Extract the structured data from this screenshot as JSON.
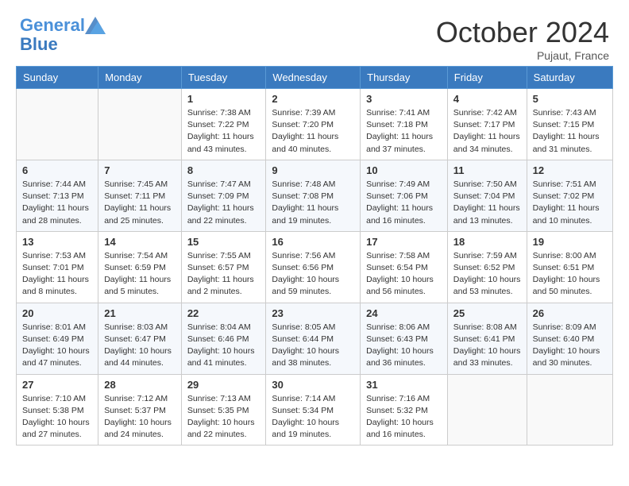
{
  "header": {
    "logo_line1": "General",
    "logo_line2": "Blue",
    "month": "October 2024",
    "location": "Pujaut, France"
  },
  "columns": [
    "Sunday",
    "Monday",
    "Tuesday",
    "Wednesday",
    "Thursday",
    "Friday",
    "Saturday"
  ],
  "weeks": [
    [
      {
        "day": "",
        "sunrise": "",
        "sunset": "",
        "daylight": ""
      },
      {
        "day": "",
        "sunrise": "",
        "sunset": "",
        "daylight": ""
      },
      {
        "day": "1",
        "sunrise": "Sunrise: 7:38 AM",
        "sunset": "Sunset: 7:22 PM",
        "daylight": "Daylight: 11 hours and 43 minutes."
      },
      {
        "day": "2",
        "sunrise": "Sunrise: 7:39 AM",
        "sunset": "Sunset: 7:20 PM",
        "daylight": "Daylight: 11 hours and 40 minutes."
      },
      {
        "day": "3",
        "sunrise": "Sunrise: 7:41 AM",
        "sunset": "Sunset: 7:18 PM",
        "daylight": "Daylight: 11 hours and 37 minutes."
      },
      {
        "day": "4",
        "sunrise": "Sunrise: 7:42 AM",
        "sunset": "Sunset: 7:17 PM",
        "daylight": "Daylight: 11 hours and 34 minutes."
      },
      {
        "day": "5",
        "sunrise": "Sunrise: 7:43 AM",
        "sunset": "Sunset: 7:15 PM",
        "daylight": "Daylight: 11 hours and 31 minutes."
      }
    ],
    [
      {
        "day": "6",
        "sunrise": "Sunrise: 7:44 AM",
        "sunset": "Sunset: 7:13 PM",
        "daylight": "Daylight: 11 hours and 28 minutes."
      },
      {
        "day": "7",
        "sunrise": "Sunrise: 7:45 AM",
        "sunset": "Sunset: 7:11 PM",
        "daylight": "Daylight: 11 hours and 25 minutes."
      },
      {
        "day": "8",
        "sunrise": "Sunrise: 7:47 AM",
        "sunset": "Sunset: 7:09 PM",
        "daylight": "Daylight: 11 hours and 22 minutes."
      },
      {
        "day": "9",
        "sunrise": "Sunrise: 7:48 AM",
        "sunset": "Sunset: 7:08 PM",
        "daylight": "Daylight: 11 hours and 19 minutes."
      },
      {
        "day": "10",
        "sunrise": "Sunrise: 7:49 AM",
        "sunset": "Sunset: 7:06 PM",
        "daylight": "Daylight: 11 hours and 16 minutes."
      },
      {
        "day": "11",
        "sunrise": "Sunrise: 7:50 AM",
        "sunset": "Sunset: 7:04 PM",
        "daylight": "Daylight: 11 hours and 13 minutes."
      },
      {
        "day": "12",
        "sunrise": "Sunrise: 7:51 AM",
        "sunset": "Sunset: 7:02 PM",
        "daylight": "Daylight: 11 hours and 10 minutes."
      }
    ],
    [
      {
        "day": "13",
        "sunrise": "Sunrise: 7:53 AM",
        "sunset": "Sunset: 7:01 PM",
        "daylight": "Daylight: 11 hours and 8 minutes."
      },
      {
        "day": "14",
        "sunrise": "Sunrise: 7:54 AM",
        "sunset": "Sunset: 6:59 PM",
        "daylight": "Daylight: 11 hours and 5 minutes."
      },
      {
        "day": "15",
        "sunrise": "Sunrise: 7:55 AM",
        "sunset": "Sunset: 6:57 PM",
        "daylight": "Daylight: 11 hours and 2 minutes."
      },
      {
        "day": "16",
        "sunrise": "Sunrise: 7:56 AM",
        "sunset": "Sunset: 6:56 PM",
        "daylight": "Daylight: 10 hours and 59 minutes."
      },
      {
        "day": "17",
        "sunrise": "Sunrise: 7:58 AM",
        "sunset": "Sunset: 6:54 PM",
        "daylight": "Daylight: 10 hours and 56 minutes."
      },
      {
        "day": "18",
        "sunrise": "Sunrise: 7:59 AM",
        "sunset": "Sunset: 6:52 PM",
        "daylight": "Daylight: 10 hours and 53 minutes."
      },
      {
        "day": "19",
        "sunrise": "Sunrise: 8:00 AM",
        "sunset": "Sunset: 6:51 PM",
        "daylight": "Daylight: 10 hours and 50 minutes."
      }
    ],
    [
      {
        "day": "20",
        "sunrise": "Sunrise: 8:01 AM",
        "sunset": "Sunset: 6:49 PM",
        "daylight": "Daylight: 10 hours and 47 minutes."
      },
      {
        "day": "21",
        "sunrise": "Sunrise: 8:03 AM",
        "sunset": "Sunset: 6:47 PM",
        "daylight": "Daylight: 10 hours and 44 minutes."
      },
      {
        "day": "22",
        "sunrise": "Sunrise: 8:04 AM",
        "sunset": "Sunset: 6:46 PM",
        "daylight": "Daylight: 10 hours and 41 minutes."
      },
      {
        "day": "23",
        "sunrise": "Sunrise: 8:05 AM",
        "sunset": "Sunset: 6:44 PM",
        "daylight": "Daylight: 10 hours and 38 minutes."
      },
      {
        "day": "24",
        "sunrise": "Sunrise: 8:06 AM",
        "sunset": "Sunset: 6:43 PM",
        "daylight": "Daylight: 10 hours and 36 minutes."
      },
      {
        "day": "25",
        "sunrise": "Sunrise: 8:08 AM",
        "sunset": "Sunset: 6:41 PM",
        "daylight": "Daylight: 10 hours and 33 minutes."
      },
      {
        "day": "26",
        "sunrise": "Sunrise: 8:09 AM",
        "sunset": "Sunset: 6:40 PM",
        "daylight": "Daylight: 10 hours and 30 minutes."
      }
    ],
    [
      {
        "day": "27",
        "sunrise": "Sunrise: 7:10 AM",
        "sunset": "Sunset: 5:38 PM",
        "daylight": "Daylight: 10 hours and 27 minutes."
      },
      {
        "day": "28",
        "sunrise": "Sunrise: 7:12 AM",
        "sunset": "Sunset: 5:37 PM",
        "daylight": "Daylight: 10 hours and 24 minutes."
      },
      {
        "day": "29",
        "sunrise": "Sunrise: 7:13 AM",
        "sunset": "Sunset: 5:35 PM",
        "daylight": "Daylight: 10 hours and 22 minutes."
      },
      {
        "day": "30",
        "sunrise": "Sunrise: 7:14 AM",
        "sunset": "Sunset: 5:34 PM",
        "daylight": "Daylight: 10 hours and 19 minutes."
      },
      {
        "day": "31",
        "sunrise": "Sunrise: 7:16 AM",
        "sunset": "Sunset: 5:32 PM",
        "daylight": "Daylight: 10 hours and 16 minutes."
      },
      {
        "day": "",
        "sunrise": "",
        "sunset": "",
        "daylight": ""
      },
      {
        "day": "",
        "sunrise": "",
        "sunset": "",
        "daylight": ""
      }
    ]
  ]
}
